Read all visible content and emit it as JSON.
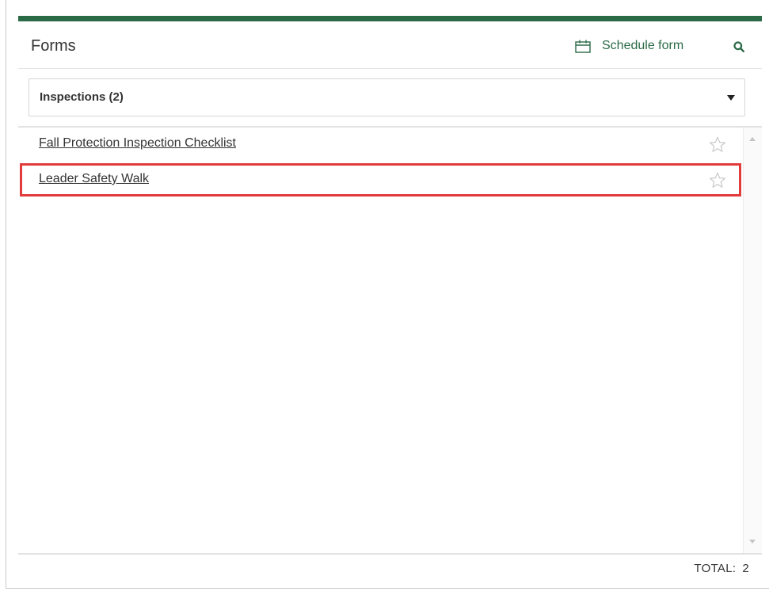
{
  "panel": {
    "title": "Forms",
    "schedule_label": "Schedule form",
    "accent_color": "#2b6a47",
    "highlight_color": "#e23b3b"
  },
  "filter": {
    "selected": "Inspections (2)"
  },
  "forms": {
    "items": [
      {
        "label": "Fall Protection Inspection Checklist",
        "favorite": false
      },
      {
        "label": "Leader Safety Walk",
        "favorite": false,
        "highlighted": true
      }
    ]
  },
  "footer": {
    "total_label": "TOTAL:",
    "total_value": "2"
  },
  "icons": {
    "schedule": "calendar-icon",
    "search": "search-icon",
    "favorite": "star-outline-icon",
    "dropdown": "caret-down-icon"
  }
}
